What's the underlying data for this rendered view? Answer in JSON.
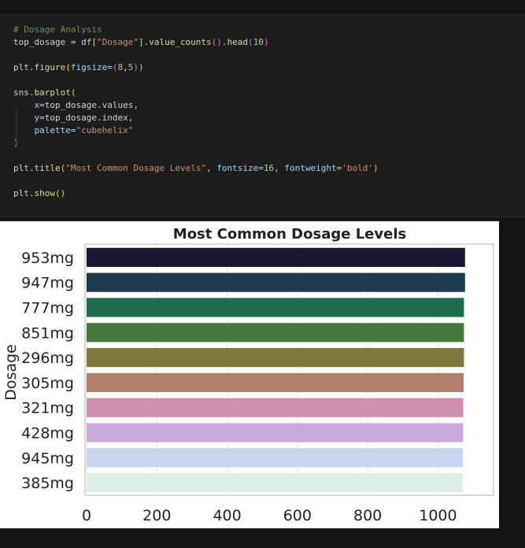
{
  "code_cell": {
    "lines": [
      "# Dosage Analysis",
      "top_dosage = df[\"Dosage\"].value_counts().head(10)",
      "",
      "plt.figure(figsize=(8,5))",
      "",
      "sns.barplot(",
      "    x=top_dosage.values,",
      "    y=top_dosage.index,",
      "    palette=\"cubehelix\"",
      ")",
      "",
      "plt.title(\"Most Common Dosage Levels\", fontsize=16, fontweight='bold')",
      "",
      "plt.show()"
    ]
  },
  "chart_data": {
    "type": "bar",
    "orientation": "horizontal",
    "title": "Most Common Dosage Levels",
    "xlabel": "",
    "ylabel": "Dosage",
    "categories": [
      "953mg",
      "947mg",
      "777mg",
      "851mg",
      "296mg",
      "305mg",
      "321mg",
      "428mg",
      "945mg",
      "385mg"
    ],
    "values": [
      1077,
      1077,
      1074,
      1074,
      1074,
      1073,
      1072,
      1072,
      1071,
      1071
    ],
    "colors": [
      "#1a1530",
      "#1e3a4f",
      "#1f6b4e",
      "#457a3c",
      "#7e7a3d",
      "#b07f6e",
      "#d08fb0",
      "#cbabdf",
      "#c8d5ef",
      "#dcefe9"
    ],
    "xlim": [
      0,
      1120
    ],
    "xticks": [
      0,
      200,
      400,
      600,
      800,
      1000
    ],
    "grid": true
  }
}
